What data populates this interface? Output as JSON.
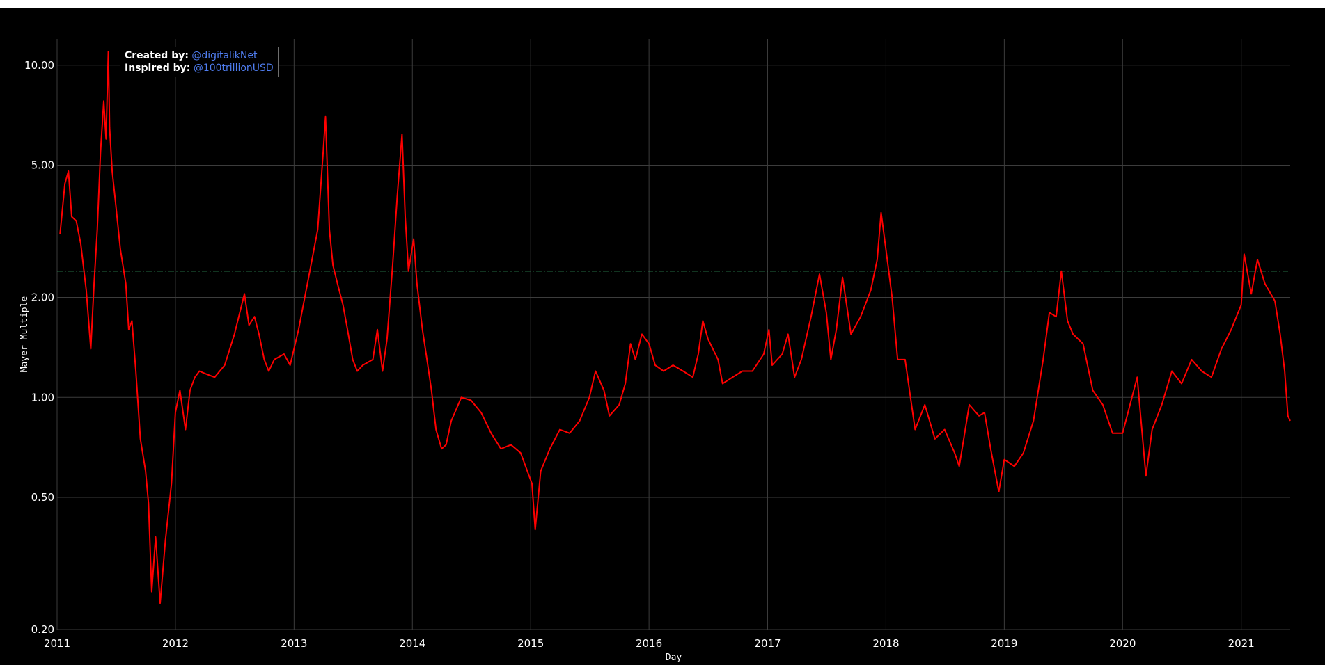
{
  "chart_data": {
    "type": "line",
    "title": "",
    "xlabel": "Day",
    "ylabel": "Mayer Multiple",
    "yscale": "log",
    "ylim": [
      0.2,
      12
    ],
    "xlim": [
      "2011-01-01",
      "2021-06-01"
    ],
    "grid": true,
    "background": "#000000",
    "line_color": "#ff0000",
    "reference_line": {
      "y": 2.4,
      "color": "#2e8b57",
      "style": "dash-dot"
    },
    "x_ticks": [
      "2011",
      "2012",
      "2013",
      "2014",
      "2015",
      "2016",
      "2017",
      "2018",
      "2019",
      "2020",
      "2021"
    ],
    "y_ticks": [
      {
        "value": 0.2,
        "label": "0.20"
      },
      {
        "value": 0.5,
        "label": "0.50"
      },
      {
        "value": 1.0,
        "label": "1.00"
      },
      {
        "value": 2.0,
        "label": "2.00"
      },
      {
        "value": 5.0,
        "label": "5.00"
      },
      {
        "value": 10.0,
        "label": "10.00"
      }
    ],
    "series": [
      {
        "values": [
          [
            "2011-01-10",
            3.1
          ],
          [
            "2011-01-25",
            4.4
          ],
          [
            "2011-02-05",
            4.8
          ],
          [
            "2011-02-15",
            3.5
          ],
          [
            "2011-03-01",
            3.4
          ],
          [
            "2011-03-15",
            2.9
          ],
          [
            "2011-04-01",
            2.1
          ],
          [
            "2011-04-15",
            1.4
          ],
          [
            "2011-04-25",
            2.2
          ],
          [
            "2011-05-05",
            3.2
          ],
          [
            "2011-05-15",
            5.5
          ],
          [
            "2011-05-25",
            7.8
          ],
          [
            "2011-06-01",
            6.0
          ],
          [
            "2011-06-08",
            11.0
          ],
          [
            "2011-06-12",
            6.5
          ],
          [
            "2011-06-20",
            4.8
          ],
          [
            "2011-07-01",
            3.8
          ],
          [
            "2011-07-15",
            2.8
          ],
          [
            "2011-08-01",
            2.2
          ],
          [
            "2011-08-10",
            1.6
          ],
          [
            "2011-08-20",
            1.7
          ],
          [
            "2011-09-01",
            1.2
          ],
          [
            "2011-09-15",
            0.75
          ],
          [
            "2011-10-01",
            0.6
          ],
          [
            "2011-10-10",
            0.48
          ],
          [
            "2011-10-20",
            0.26
          ],
          [
            "2011-11-01",
            0.38
          ],
          [
            "2011-11-15",
            0.24
          ],
          [
            "2011-12-01",
            0.37
          ],
          [
            "2011-12-20",
            0.55
          ],
          [
            "2012-01-01",
            0.9
          ],
          [
            "2012-01-15",
            1.05
          ],
          [
            "2012-02-01",
            0.8
          ],
          [
            "2012-02-15",
            1.05
          ],
          [
            "2012-03-01",
            1.15
          ],
          [
            "2012-03-15",
            1.2
          ],
          [
            "2012-04-01",
            1.18
          ],
          [
            "2012-05-01",
            1.15
          ],
          [
            "2012-06-01",
            1.25
          ],
          [
            "2012-07-01",
            1.55
          ],
          [
            "2012-08-01",
            2.05
          ],
          [
            "2012-08-15",
            1.65
          ],
          [
            "2012-09-01",
            1.75
          ],
          [
            "2012-09-15",
            1.55
          ],
          [
            "2012-10-01",
            1.3
          ],
          [
            "2012-10-15",
            1.2
          ],
          [
            "2012-11-01",
            1.3
          ],
          [
            "2012-12-01",
            1.35
          ],
          [
            "2012-12-20",
            1.25
          ],
          [
            "2013-01-15",
            1.6
          ],
          [
            "2013-02-15",
            2.3
          ],
          [
            "2013-03-15",
            3.2
          ],
          [
            "2013-04-01",
            5.5
          ],
          [
            "2013-04-08",
            7.0
          ],
          [
            "2013-04-20",
            3.2
          ],
          [
            "2013-05-01",
            2.5
          ],
          [
            "2013-05-15",
            2.2
          ],
          [
            "2013-06-01",
            1.9
          ],
          [
            "2013-06-15",
            1.6
          ],
          [
            "2013-07-01",
            1.3
          ],
          [
            "2013-07-15",
            1.2
          ],
          [
            "2013-08-01",
            1.25
          ],
          [
            "2013-09-01",
            1.3
          ],
          [
            "2013-09-15",
            1.6
          ],
          [
            "2013-10-01",
            1.2
          ],
          [
            "2013-10-15",
            1.5
          ],
          [
            "2013-11-01",
            2.5
          ],
          [
            "2013-11-15",
            4.0
          ],
          [
            "2013-11-30",
            6.2
          ],
          [
            "2013-12-10",
            3.5
          ],
          [
            "2013-12-20",
            2.4
          ],
          [
            "2014-01-05",
            3.0
          ],
          [
            "2014-01-15",
            2.2
          ],
          [
            "2014-02-01",
            1.6
          ],
          [
            "2014-02-15",
            1.3
          ],
          [
            "2014-03-01",
            1.05
          ],
          [
            "2014-03-15",
            0.8
          ],
          [
            "2014-04-01",
            0.7
          ],
          [
            "2014-04-15",
            0.72
          ],
          [
            "2014-05-01",
            0.85
          ],
          [
            "2014-06-01",
            1.0
          ],
          [
            "2014-07-01",
            0.98
          ],
          [
            "2014-08-01",
            0.9
          ],
          [
            "2014-09-01",
            0.78
          ],
          [
            "2014-10-01",
            0.7
          ],
          [
            "2014-11-01",
            0.72
          ],
          [
            "2014-12-01",
            0.68
          ],
          [
            "2015-01-05",
            0.55
          ],
          [
            "2015-01-15",
            0.4
          ],
          [
            "2015-02-01",
            0.6
          ],
          [
            "2015-03-01",
            0.7
          ],
          [
            "2015-04-01",
            0.8
          ],
          [
            "2015-05-01",
            0.78
          ],
          [
            "2015-06-01",
            0.85
          ],
          [
            "2015-07-01",
            1.0
          ],
          [
            "2015-07-20",
            1.2
          ],
          [
            "2015-08-15",
            1.05
          ],
          [
            "2015-09-01",
            0.88
          ],
          [
            "2015-10-01",
            0.95
          ],
          [
            "2015-10-20",
            1.1
          ],
          [
            "2015-11-05",
            1.45
          ],
          [
            "2015-11-20",
            1.3
          ],
          [
            "2015-12-10",
            1.55
          ],
          [
            "2016-01-01",
            1.45
          ],
          [
            "2016-01-20",
            1.25
          ],
          [
            "2016-02-15",
            1.2
          ],
          [
            "2016-03-15",
            1.25
          ],
          [
            "2016-04-15",
            1.2
          ],
          [
            "2016-05-15",
            1.15
          ],
          [
            "2016-06-01",
            1.35
          ],
          [
            "2016-06-15",
            1.7
          ],
          [
            "2016-07-01",
            1.5
          ],
          [
            "2016-08-01",
            1.3
          ],
          [
            "2016-08-15",
            1.1
          ],
          [
            "2016-09-15",
            1.15
          ],
          [
            "2016-10-15",
            1.2
          ],
          [
            "2016-11-15",
            1.2
          ],
          [
            "2016-12-20",
            1.35
          ],
          [
            "2017-01-05",
            1.6
          ],
          [
            "2017-01-15",
            1.25
          ],
          [
            "2017-02-15",
            1.35
          ],
          [
            "2017-03-05",
            1.55
          ],
          [
            "2017-03-25",
            1.15
          ],
          [
            "2017-04-15",
            1.3
          ],
          [
            "2017-05-15",
            1.75
          ],
          [
            "2017-06-10",
            2.35
          ],
          [
            "2017-07-01",
            1.8
          ],
          [
            "2017-07-15",
            1.3
          ],
          [
            "2017-08-01",
            1.6
          ],
          [
            "2017-08-20",
            2.3
          ],
          [
            "2017-09-15",
            1.55
          ],
          [
            "2017-10-15",
            1.75
          ],
          [
            "2017-11-15",
            2.1
          ],
          [
            "2017-12-05",
            2.6
          ],
          [
            "2017-12-17",
            3.6
          ],
          [
            "2018-01-05",
            2.6
          ],
          [
            "2018-01-20",
            2.0
          ],
          [
            "2018-02-06",
            1.3
          ],
          [
            "2018-03-01",
            1.3
          ],
          [
            "2018-04-01",
            0.8
          ],
          [
            "2018-05-01",
            0.95
          ],
          [
            "2018-06-01",
            0.75
          ],
          [
            "2018-07-01",
            0.8
          ],
          [
            "2018-08-01",
            0.68
          ],
          [
            "2018-08-15",
            0.62
          ],
          [
            "2018-09-15",
            0.95
          ],
          [
            "2018-10-15",
            0.88
          ],
          [
            "2018-11-01",
            0.9
          ],
          [
            "2018-11-20",
            0.7
          ],
          [
            "2018-12-15",
            0.52
          ],
          [
            "2019-01-01",
            0.65
          ],
          [
            "2019-02-01",
            0.62
          ],
          [
            "2019-03-01",
            0.68
          ],
          [
            "2019-04-01",
            0.85
          ],
          [
            "2019-05-01",
            1.3
          ],
          [
            "2019-05-20",
            1.8
          ],
          [
            "2019-06-10",
            1.75
          ],
          [
            "2019-06-26",
            2.4
          ],
          [
            "2019-07-15",
            1.7
          ],
          [
            "2019-08-01",
            1.55
          ],
          [
            "2019-09-01",
            1.45
          ],
          [
            "2019-10-01",
            1.05
          ],
          [
            "2019-11-01",
            0.95
          ],
          [
            "2019-12-01",
            0.78
          ],
          [
            "2020-01-01",
            0.78
          ],
          [
            "2020-02-15",
            1.15
          ],
          [
            "2020-03-13",
            0.58
          ],
          [
            "2020-04-01",
            0.8
          ],
          [
            "2020-05-01",
            0.95
          ],
          [
            "2020-06-01",
            1.2
          ],
          [
            "2020-07-01",
            1.1
          ],
          [
            "2020-08-01",
            1.3
          ],
          [
            "2020-09-01",
            1.2
          ],
          [
            "2020-10-01",
            1.15
          ],
          [
            "2020-11-01",
            1.4
          ],
          [
            "2020-12-01",
            1.6
          ],
          [
            "2021-01-01",
            1.9
          ],
          [
            "2021-01-10",
            2.7
          ],
          [
            "2021-02-01",
            2.05
          ],
          [
            "2021-02-20",
            2.6
          ],
          [
            "2021-03-15",
            2.2
          ],
          [
            "2021-04-15",
            1.95
          ],
          [
            "2021-05-01",
            1.55
          ],
          [
            "2021-05-15",
            1.2
          ],
          [
            "2021-05-25",
            0.88
          ],
          [
            "2021-06-01",
            0.85
          ]
        ]
      }
    ]
  },
  "credits": {
    "created_label": "Created by:",
    "created_handle": "@digitalikNet",
    "inspired_label": "Inspired by:",
    "inspired_handle": "@100trillionUSD"
  }
}
